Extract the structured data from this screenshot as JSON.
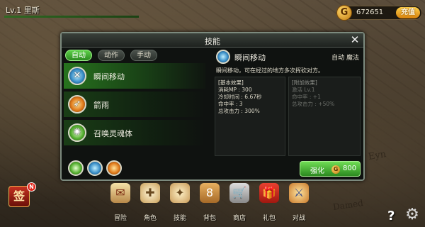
{
  "player": {
    "level_name": "Lv.1 里斯"
  },
  "currency": {
    "amount": "672651",
    "coin_glyph": "G",
    "recharge_label": "充值"
  },
  "map": {
    "text_1": "Eyn",
    "text_2": "Damed"
  },
  "dialog": {
    "title": "技能",
    "close_glyph": "✕",
    "tabs": [
      {
        "label": "自动",
        "active": true
      },
      {
        "label": "动作",
        "active": false
      },
      {
        "label": "手动",
        "active": false
      }
    ],
    "skills": [
      {
        "name": "瞬间移动",
        "icon": "blink-skill-icon",
        "selected": true
      },
      {
        "name": "箭雨",
        "icon": "arrow-rain-skill-icon",
        "selected": false
      },
      {
        "name": "召唤灵魂体",
        "icon": "summon-spirit-skill-icon",
        "selected": false
      }
    ],
    "detail": {
      "name": "瞬间移动",
      "tags": "自动 魔法",
      "description": "瞬间移动，可在经过的地方多次挥砍对方。",
      "basic_effects": {
        "heading": "[基本效果]",
        "lines": [
          "消耗MP : 300",
          "冷却时间 : 6.67秒",
          "命中率 : 3",
          "总攻击力 : 300%"
        ]
      },
      "extra_effects": {
        "heading": "[附加效果]",
        "lines": [
          "激活 Lv.1",
          "命中率 : +1",
          "总攻击力 : +50%"
        ]
      }
    },
    "upgrade": {
      "label": "强化",
      "coin_glyph": "G",
      "cost": "800"
    }
  },
  "nav": {
    "sign": {
      "label": "签",
      "badge": "N"
    },
    "items": [
      {
        "label": "冒险",
        "glyph": "✉"
      },
      {
        "label": "角色",
        "glyph": "✚"
      },
      {
        "label": "技能",
        "glyph": "✦"
      },
      {
        "label": "背包",
        "glyph": "8"
      },
      {
        "label": "商店",
        "glyph": "🛒"
      },
      {
        "label": "礼包",
        "glyph": "🎁"
      },
      {
        "label": "对战",
        "glyph": "⚔"
      }
    ],
    "help_glyph": "?",
    "settings_glyph": "⚙"
  },
  "colors": {
    "accent_green": "#2b8a1f",
    "gold": "#d7820c"
  }
}
